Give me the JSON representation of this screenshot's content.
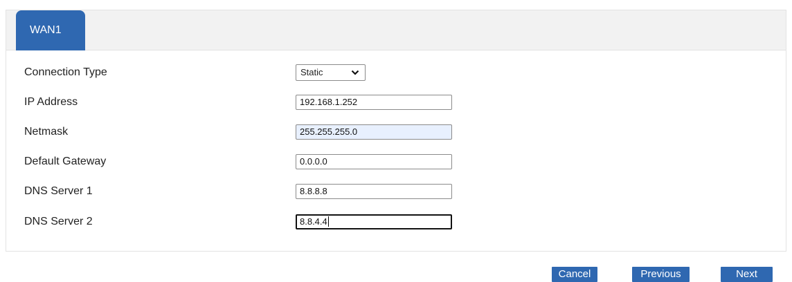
{
  "tabs": [
    {
      "label": "WAN1",
      "active": true
    }
  ],
  "form": {
    "connection_type": {
      "label": "Connection Type",
      "value": "Static"
    },
    "ip_address": {
      "label": "IP Address",
      "value": "192.168.1.252"
    },
    "netmask": {
      "label": "Netmask",
      "value": "255.255.255.0"
    },
    "default_gateway": {
      "label": "Default Gateway",
      "value": "0.0.0.0"
    },
    "dns_server_1": {
      "label": "DNS Server 1",
      "value": "8.8.8.8"
    },
    "dns_server_2": {
      "label": "DNS Server 2",
      "value": "8.8.4.4"
    }
  },
  "buttons": {
    "cancel": "Cancel",
    "previous": "Previous",
    "next": "Next"
  },
  "colors": {
    "accent": "#2f68b1",
    "autofill": "#e8f0fe"
  },
  "icons": {
    "select_arrow": "chevron-down-icon"
  }
}
